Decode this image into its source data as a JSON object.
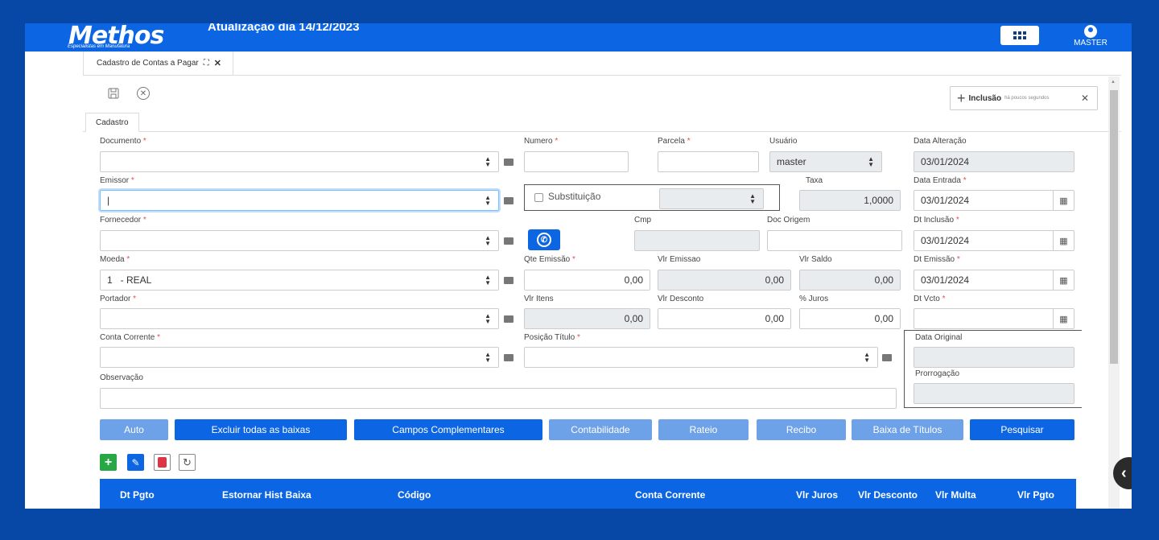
{
  "header": {
    "logo": "Methos",
    "logo_sub": "Especialistas em Manufatura",
    "update_text": "Atualização dia 14/12/2023",
    "user_name": "MASTER"
  },
  "tabs": {
    "active_doc": "Cadastro de Contas a Pagar",
    "form_tab": "Cadastro"
  },
  "notification": {
    "title": "Inclusão",
    "time": "há poucos segundos"
  },
  "form": {
    "documento": {
      "label": "Documento",
      "value": ""
    },
    "numero": {
      "label": "Numero",
      "value": ""
    },
    "parcela": {
      "label": "Parcela",
      "value": ""
    },
    "usuario": {
      "label": "Usuário",
      "value": "master"
    },
    "data_alteracao": {
      "label": "Data Alteração",
      "value": "03/01/2024"
    },
    "emissor": {
      "label": "Emissor",
      "value": "|"
    },
    "substituicao": {
      "label": "Substituição",
      "checked": false
    },
    "taxa": {
      "label": "Taxa",
      "value": "1,0000"
    },
    "data_entrada": {
      "label": "Data Entrada",
      "value": "03/01/2024"
    },
    "fornecedor": {
      "label": "Fornecedor",
      "value": ""
    },
    "cmp": {
      "label": "Cmp",
      "value": ""
    },
    "doc_origem": {
      "label": "Doc Origem",
      "value": ""
    },
    "dt_inclusao": {
      "label": "Dt Inclusão",
      "value": "03/01/2024"
    },
    "moeda": {
      "label": "Moeda",
      "value": "1   - REAL"
    },
    "qte_emissao": {
      "label": "Qte Emissão",
      "value": "0,00"
    },
    "vlr_emissao": {
      "label": "Vlr Emissao",
      "value": "0,00"
    },
    "vlr_saldo": {
      "label": "Vlr Saldo",
      "value": "0,00"
    },
    "dt_emissao": {
      "label": "Dt Emissão",
      "value": "03/01/2024"
    },
    "portador": {
      "label": "Portador",
      "value": ""
    },
    "vlr_itens": {
      "label": "Vlr Itens",
      "value": "0,00"
    },
    "vlr_desconto": {
      "label": "Vlr Desconto",
      "value": "0,00"
    },
    "juros": {
      "label": "% Juros",
      "value": "0,00"
    },
    "dt_vcto": {
      "label": "Dt Vcto",
      "value": ""
    },
    "conta_corrente": {
      "label": "Conta Corrente",
      "value": ""
    },
    "posicao_titulo": {
      "label": "Posição Título",
      "value": ""
    },
    "data_original": {
      "label": "Data Original",
      "value": ""
    },
    "observacao": {
      "label": "Observação",
      "value": ""
    },
    "prorrogacao": {
      "label": "Prorrogação",
      "value": ""
    },
    "required_mark": "*"
  },
  "buttons": {
    "auto": "Auto",
    "excluir": "Excluir todas as baixas",
    "campos": "Campos Complementares",
    "contabilidade": "Contabilidade",
    "rateio": "Rateio",
    "recibo": "Recibo",
    "baixa": "Baixa de Títulos",
    "pesquisar": "Pesquisar"
  },
  "grid": {
    "columns": [
      "Dt Pgto",
      "Estornar Hist Baixa",
      "Código",
      "Conta Corrente",
      "Vlr Juros",
      "Vlr Desconto",
      "Vlr Multa",
      "Vlr Pgto"
    ]
  },
  "colors": {
    "background": "#0747a6",
    "primary": "#0c66e4",
    "primary_dim": "#6ea2e8",
    "add_green": "#28a745",
    "delete_red": "#dc3545"
  }
}
